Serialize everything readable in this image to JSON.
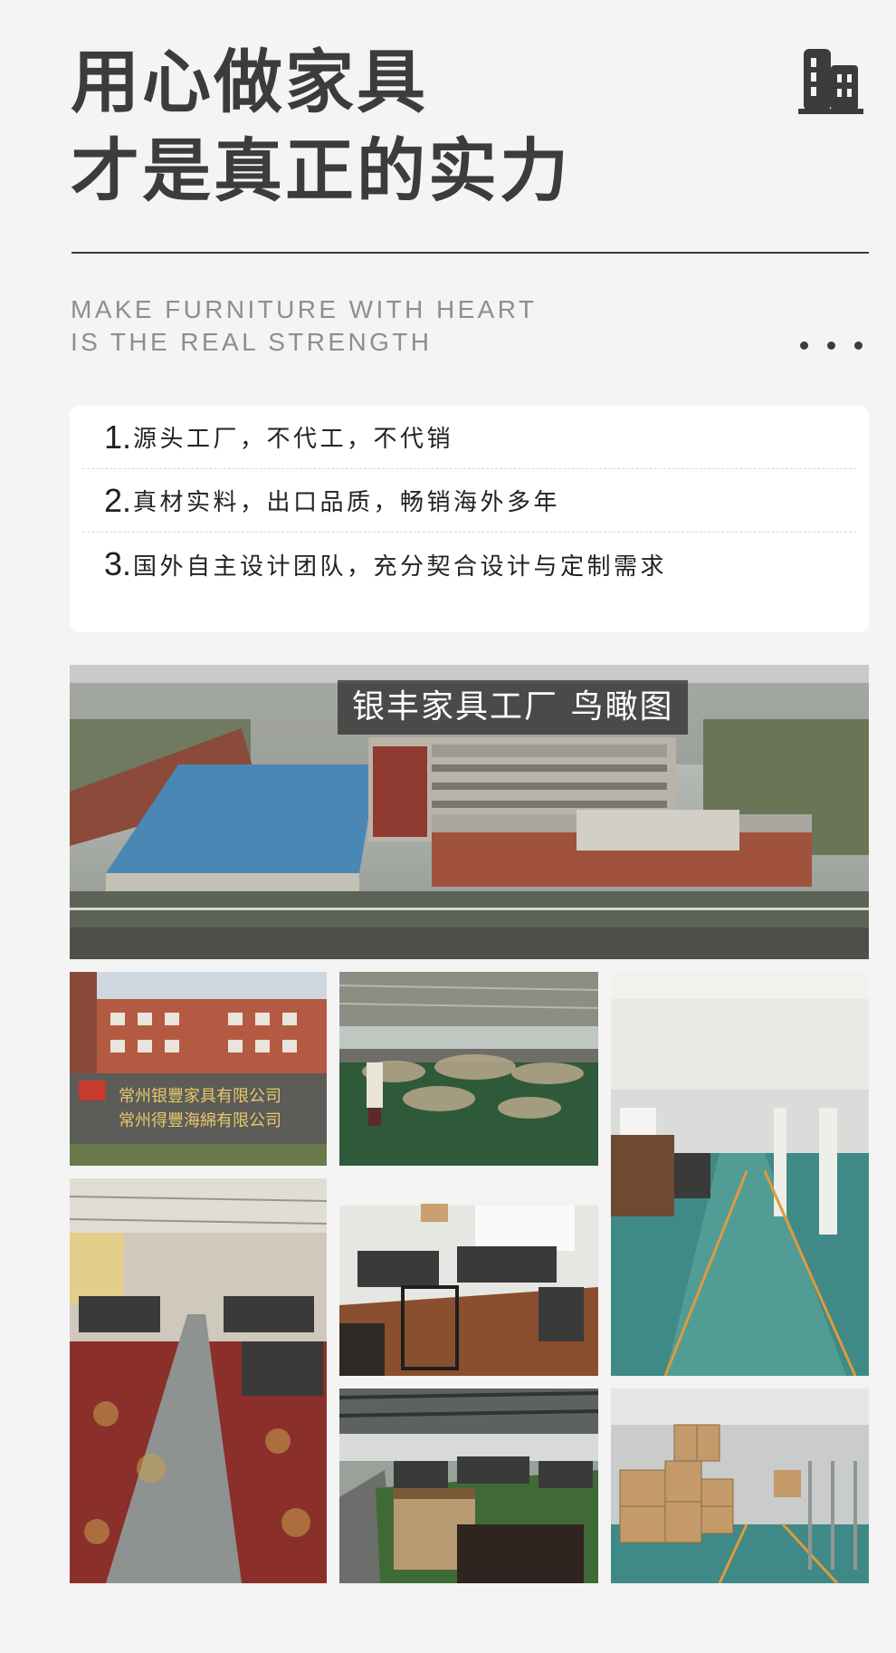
{
  "hero": {
    "title_line1": "用心做家具",
    "title_line2": "才是真正的实力",
    "icon": "building-icon"
  },
  "subtitle": {
    "line1": "MAKE FURNITURE WITH HEART",
    "line2": "IS THE REAL STRENGTH"
  },
  "features": [
    {
      "num": "1.",
      "text": "源头工厂，不代工，不代销"
    },
    {
      "num": "2.",
      "text": "真材实料，出口品质，畅销海外多年"
    },
    {
      "num": "3.",
      "text": "国外自主设计团队，充分契合设计与定制需求"
    }
  ],
  "aerial": {
    "caption": "银丰家具工厂 鸟瞰图"
  },
  "gallery": {
    "sign_line1": "常州银豐家具有限公司",
    "sign_line2": "常州得豐海綿有限公司"
  },
  "colors": {
    "heading": "#3c3c3c",
    "subtitle": "#8e8e8e",
    "card": "#ffffff",
    "page_bg": "#f4f4f4"
  }
}
